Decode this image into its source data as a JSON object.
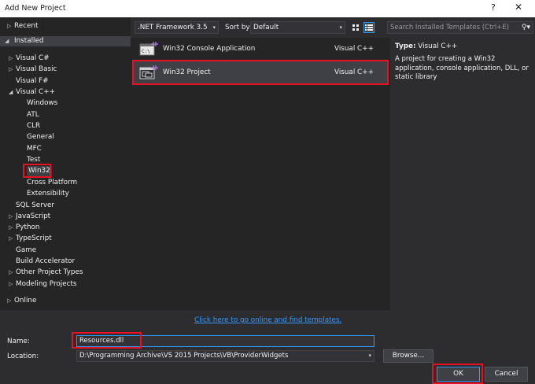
{
  "window": {
    "title": "Add New Project",
    "help_glyph": "?",
    "close_glyph": "✕"
  },
  "tree": {
    "recent": "Recent",
    "installed": "Installed",
    "visual_csharp": "Visual C#",
    "visual_basic": "Visual Basic",
    "visual_fsharp": "Visual F#",
    "visual_cpp": "Visual C++",
    "windows": "Windows",
    "atl": "ATL",
    "clr": "CLR",
    "general": "General",
    "mfc": "MFC",
    "test": "Test",
    "win32": "Win32",
    "cross_platform": "Cross Platform",
    "extensibility": "Extensibility",
    "sql_server": "SQL Server",
    "javascript": "JavaScript",
    "python": "Python",
    "typescript": "TypeScript",
    "game": "Game",
    "build_accelerator": "Build Accelerator",
    "other_project_types": "Other Project Types",
    "modeling_projects": "Modeling Projects",
    "online": "Online"
  },
  "toolbar": {
    "framework": ".NET Framework 3.5",
    "sort_label": "Sort by:",
    "sort_value": "Default",
    "search_placeholder": "Search Installed Templates (Ctrl+E)"
  },
  "templates": [
    {
      "name": "Win32 Console Application",
      "lang": "Visual C++"
    },
    {
      "name": "Win32 Project",
      "lang": "Visual C++"
    }
  ],
  "details": {
    "type_label": "Type:",
    "type_value": "Visual C++",
    "description": "A project for creating a Win32 application, console application, DLL, or static library"
  },
  "online_link": "Click here to go online and find templates.",
  "form": {
    "name_label": "Name:",
    "name_value": "Resources.dll",
    "location_label": "Location:",
    "location_value": "D:\\Programming Archive\\VS 2015 Projects\\VB\\ProviderWidgets",
    "browse": "Browse...",
    "ok": "OK",
    "cancel": "Cancel"
  },
  "colors": {
    "background": "#2d2d30",
    "pane": "#252526",
    "selection": "#3f3f46",
    "highlight": "#e81123",
    "accent": "#3399ff",
    "icon_accent": "#b180d7"
  }
}
